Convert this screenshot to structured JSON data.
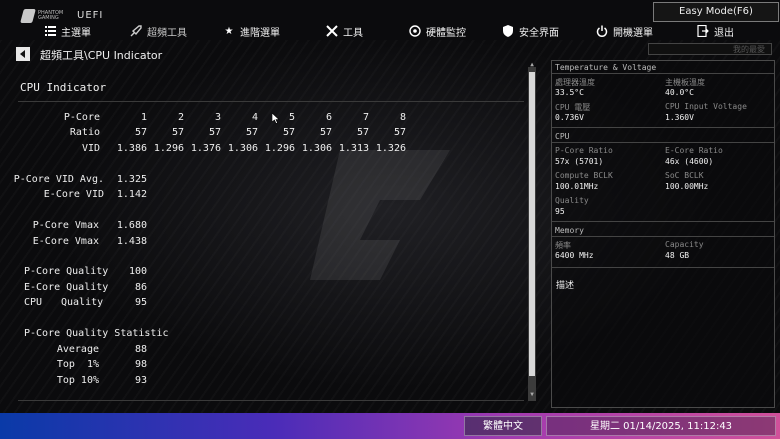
{
  "header": {
    "brand_line1": "PHANTOM",
    "brand_line2": "GAMING",
    "uefi_label": "UEFI",
    "easy_mode_label": "Easy Mode(F6)",
    "search_placeholder": "我的最愛",
    "tabs": [
      {
        "label": "主選單",
        "icon": "list-icon"
      },
      {
        "label": "超頻工具",
        "icon": "rocket-icon",
        "active": true
      },
      {
        "label": "進階選單",
        "icon": "star-icon"
      },
      {
        "label": "工具",
        "icon": "tools-icon"
      },
      {
        "label": "硬體監控",
        "icon": "monitor-icon"
      },
      {
        "label": "安全界面",
        "icon": "shield-icon"
      },
      {
        "label": "開機選單",
        "icon": "power-icon"
      },
      {
        "label": "退出",
        "icon": "exit-icon"
      }
    ]
  },
  "breadcrumb": "超頻工具\\CPU Indicator",
  "main": {
    "section_title": "CPU Indicator",
    "pcore_label": "P-Core",
    "ratio_label": "Ratio",
    "vid_label": "VID",
    "cores": [
      "1",
      "2",
      "3",
      "4",
      "5",
      "6",
      "7",
      "8"
    ],
    "ratios": [
      "57",
      "57",
      "57",
      "57",
      "57",
      "57",
      "57",
      "57"
    ],
    "vids": [
      "1.386",
      "1.296",
      "1.376",
      "1.306",
      "1.296",
      "1.306",
      "1.313",
      "1.326"
    ],
    "pcore_vid_avg_label": "P-Core VID Avg.",
    "pcore_vid_avg": "1.325",
    "ecore_vid_label": "E-Core VID",
    "ecore_vid": "1.142",
    "pcore_vmax_label": "P-Core Vmax",
    "pcore_vmax": "1.680",
    "ecore_vmax_label": "E-Core Vmax",
    "ecore_vmax": "1.438",
    "pcore_quality_label": "P-Core Quality",
    "pcore_quality": "100",
    "ecore_quality_label": "E-Core Quality",
    "ecore_quality": "86",
    "cpu_label": "CPU",
    "quality_label": "Quality",
    "cpu_quality": "95",
    "statistic_label": "P-Core Quality Statistic",
    "average_label": "Average",
    "average": "88",
    "top1_label": "Top  1%",
    "top1": "98",
    "top10_label": "Top 10%",
    "top10": "93"
  },
  "right_panel": {
    "temp_header": "Temperature & Voltage",
    "cpu_temp_label": "處理器溫度",
    "cpu_temp": "33.5°C",
    "mb_temp_label": "主機板溫度",
    "mb_temp": "40.0°C",
    "cpu_voltage_label": "CPU 電壓",
    "cpu_voltage": "0.736V",
    "cpu_input_voltage_label": "CPU Input Voltage",
    "cpu_input_voltage": "1.360V",
    "cpu_header": "CPU",
    "pcore_ratio_label": "P-Core Ratio",
    "pcore_ratio": "57x (5701)",
    "ecore_ratio_label": "E-Core Ratio",
    "ecore_ratio": "46x (4600)",
    "compute_bclk_label": "Compute BCLK",
    "compute_bclk": "100.01MHz",
    "soc_bclk_label": "SoC BCLK",
    "soc_bclk": "100.00MHz",
    "quality_label": "Quality",
    "quality": "95",
    "memory_header": "Memory",
    "freq_label": "頻率",
    "freq": "6400 MHz",
    "capacity_label": "Capacity",
    "capacity": "48 GB",
    "description_label": "描述"
  },
  "footer": {
    "language": "繁體中文",
    "datetime": "星期二 01/14/2025, 11:12:43"
  }
}
